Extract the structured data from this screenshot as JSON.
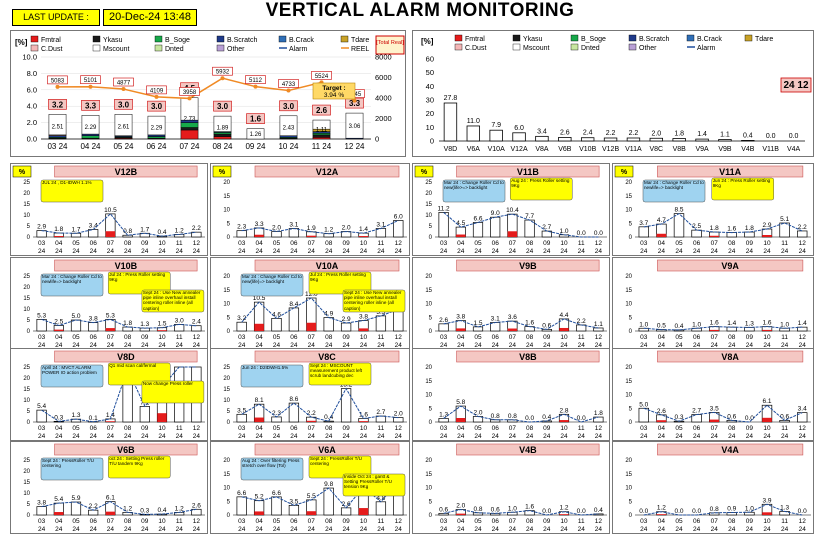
{
  "header": {
    "last_update_label": "LAST UPDATE :",
    "last_update_value": "20-Dec-24 13:48",
    "title": "VERTICAL ALARM MONITORING"
  },
  "colors": {
    "bar_outline": "#000000",
    "trend": "#1f4e9c",
    "reel": "#f08a24",
    "target": "#ffd966",
    "panel_title_bg": "#f4c7c3",
    "yellow": "#ffff00",
    "callout": "#9fd3f0"
  },
  "chart_data": [
    {
      "type": "bar",
      "id": "monthly",
      "unit_label": "[%]",
      "total_label": "[Total Real]",
      "categories": [
        "03 24",
        "04 24",
        "05 24",
        "06 24",
        "07 24",
        "08 24",
        "09 24",
        "10 24",
        "11 24",
        "12 24"
      ],
      "ylim": [
        0,
        10
      ],
      "y2lim": [
        0,
        8000
      ],
      "yticks": [
        "0.0",
        "2.0",
        "4.0",
        "6.0",
        "8.0",
        "10.0"
      ],
      "y2ticks": [
        "0",
        "2000",
        "4000",
        "6000",
        "8000"
      ],
      "legend": [
        "Fmtral",
        "Ykasu",
        "B_Soge",
        "B.Scratch",
        "B.Crack",
        "Tdare",
        "C.Dust",
        "Mscount",
        "Dnted",
        "Other",
        "Alarm",
        "REEL"
      ],
      "series": [
        {
          "name": "Fmtral",
          "color": "#e51c1c",
          "values": [
            0,
            0,
            0.1,
            0,
            1.1,
            0.3,
            0,
            0,
            0.2,
            0
          ]
        },
        {
          "name": "Ykasu",
          "color": "#1a1a1a",
          "values": [
            0.1,
            0.1,
            0.1,
            0.1,
            0.3,
            0.3,
            0,
            0.1,
            0.3,
            0
          ]
        },
        {
          "name": "B_Soge",
          "color": "#17a84a",
          "values": [
            0.1,
            0.3,
            0.1,
            0.2,
            0.6,
            0.2,
            0,
            0.1,
            0.2,
            0
          ]
        },
        {
          "name": "B.Scratch",
          "color": "#1f3a8a",
          "values": [
            0.2,
            0.2,
            0.1,
            0.2,
            0.3,
            0.1,
            0,
            0.2,
            0.2,
            0.1
          ]
        },
        {
          "name": "B.Crack",
          "color": "#2f6fb7",
          "values": [
            0,
            0,
            0,
            0,
            0,
            0,
            0,
            0,
            0,
            0
          ]
        },
        {
          "name": "Tdare",
          "color": "#c9a227",
          "values": [
            0,
            0,
            0,
            0,
            0,
            0,
            0,
            0,
            0.3,
            0
          ]
        },
        {
          "name": "C.Dust",
          "color": "#f4b6b6",
          "values": [
            0.1,
            0,
            0,
            0,
            0,
            0,
            0,
            0,
            0,
            0
          ]
        },
        {
          "name": "Mscount",
          "color": "#ffffff",
          "values": [
            2.51,
            2.29,
            2.61,
            2.29,
            2.73,
            1.89,
            1.26,
            2.43,
            1.11,
            3.06
          ]
        },
        {
          "name": "Dnted",
          "color": "#c8e6a0",
          "values": [
            0,
            0,
            0,
            0,
            0,
            0,
            0,
            0,
            0,
            0
          ]
        },
        {
          "name": "Other",
          "color": "#b9a0d6",
          "values": [
            0,
            0,
            0,
            0,
            0,
            0,
            0,
            0,
            0,
            0
          ]
        }
      ],
      "totals": [
        "3.2",
        "3.3",
        "3.0",
        "3.0",
        "4.5",
        "3.0",
        "1.6",
        "3.0",
        "2.6",
        "3.3"
      ],
      "inner_labels": [
        "2.51",
        "2.29",
        "2.61",
        "2.29",
        "2.73",
        "1.89",
        "1.26",
        "2.43",
        "1.11",
        "3.06"
      ],
      "alarm_line": [
        3.2,
        3.3,
        3.0,
        3.0,
        4.5,
        3.0,
        1.6,
        3.0,
        2.6,
        3.3
      ],
      "reel": [
        5083,
        5101,
        4877,
        4109,
        3958,
        5932,
        5112,
        4733,
        5524,
        3745
      ],
      "reel_labels": [
        "5083",
        "5101",
        "4877",
        "4109",
        "3958",
        "5932",
        "5112",
        "4733",
        "5524",
        "3745"
      ],
      "target_label": "Target :",
      "target_value": "3.94 %"
    },
    {
      "type": "bar",
      "id": "machines",
      "unit_label": "[%]",
      "categories": [
        "V8D",
        "V6A",
        "V10A",
        "V12A",
        "V8A",
        "V6B",
        "V10B",
        "V12B",
        "V11A",
        "V8C",
        "V8B",
        "V9A",
        "V9B",
        "V4B",
        "V11B",
        "V4A"
      ],
      "values": [
        27.8,
        11.0,
        7.9,
        6.0,
        3.4,
        2.6,
        2.4,
        2.2,
        2.2,
        2.0,
        1.8,
        1.4,
        1.1,
        0.4,
        0.0,
        0.0
      ],
      "value_labels": [
        "27.8",
        "11.0",
        "7.9",
        "6.0",
        "3.4",
        "2.6",
        "2.4",
        "2.2",
        "2.2",
        "2.0",
        "1.8",
        "1.4",
        "1.1",
        "0.4",
        "0.0",
        "0.0"
      ],
      "ylim": [
        0,
        60
      ],
      "yticks": [
        "0",
        "10",
        "20",
        "30",
        "40",
        "50",
        "60"
      ],
      "legend": [
        "Fmtral",
        "Ykasu",
        "B_Soge",
        "B.Scratch",
        "B.Crack",
        "Tdare",
        "C.Dust",
        "Mscount",
        "Dnted",
        "Other",
        "Alarm"
      ],
      "badge": "24 12"
    }
  ],
  "machine_months": [
    "03",
    "04",
    "05",
    "06",
    "07",
    "08",
    "09",
    "10",
    "11",
    "12"
  ],
  "machine_year": "24",
  "machines": [
    {
      "name": "V12B",
      "pct": "%",
      "values": [
        2.9,
        1.8,
        1.7,
        3.4,
        10.5,
        0.8,
        1.7,
        0.4,
        1.2,
        2.2
      ],
      "labels": [
        "2.9",
        "1.8",
        "1.7",
        "3.4",
        "10.5",
        "0.8",
        "1.7",
        "0.4",
        "1.2",
        "2.2"
      ],
      "ylim": [
        0,
        25
      ],
      "yticks": [
        "0",
        "5",
        "10",
        "15",
        "20",
        "25"
      ],
      "callouts": [
        "JUL 24 , D1-IDWH 1.1%"
      ]
    },
    {
      "name": "V12A",
      "pct": "%",
      "values": [
        2.3,
        3.3,
        2.0,
        3.1,
        1.9,
        1.2,
        2.0,
        1.4,
        3.1,
        6.0
      ],
      "labels": [
        "2.3",
        "3.3",
        "2.0",
        "3.1",
        "1.9",
        "1.2",
        "2.0",
        "1.4",
        "3.1",
        "6.0"
      ],
      "ylim": [
        0,
        20
      ],
      "yticks": [
        "0",
        "5",
        "10",
        "15",
        "20"
      ],
      "callouts": []
    },
    {
      "name": "V11B",
      "pct": "%",
      "values": [
        11.2,
        4.5,
        6.6,
        9.0,
        10.4,
        7.7,
        2.7,
        1.0,
        0.0,
        0.0
      ],
      "labels": [
        "11.2",
        "4.5",
        "6.6",
        "9.0",
        "10.4",
        "7.7",
        "2.7",
        "1.0",
        "0.0",
        "0.0"
      ],
      "ylim": [
        0,
        25
      ],
      "yticks": [
        "0",
        "5",
        "10",
        "15",
        "20",
        "25"
      ],
      "callouts": [
        "Mar 24 : Change Roller Cd to new(life>=> backlight",
        "Aug 24 : Press Roller setting 9Kg"
      ]
    },
    {
      "name": "V11A",
      "pct": "%",
      "values": [
        3.7,
        4.7,
        8.5,
        2.5,
        1.8,
        1.6,
        1.8,
        2.9,
        5.1,
        2.2
      ],
      "labels": [
        "3.7",
        "4.7",
        "8.5",
        "2.5",
        "1.8",
        "1.6",
        "1.8",
        "2.9",
        "5.1",
        "2.2"
      ],
      "ylim": [
        0,
        20
      ],
      "yticks": [
        "0",
        "5",
        "10",
        "15",
        "20"
      ],
      "callouts": [
        "Mar 24 : Change Roller Cd to newlife=> backlight",
        "Jun 24 : Press Roller setting 9Kg"
      ]
    },
    {
      "name": "V10B",
      "pct": "",
      "values": [
        5.3,
        2.5,
        5.0,
        3.8,
        5.3,
        1.8,
        1.3,
        1.5,
        3.0,
        2.4
      ],
      "labels": [
        "5.3",
        "2.5",
        "5.0",
        "3.8",
        "5.3",
        "1.8",
        "1.3",
        "1.5",
        "3.0",
        "2.4"
      ],
      "ylim": [
        0,
        25
      ],
      "yticks": [
        "0",
        "5",
        "10",
        "15",
        "20",
        "25"
      ],
      "callouts": [
        "Mar 24 : Change Roller Cd to newlife=> backlight",
        "Jul 24 : Press Roller setting 9Kg",
        "Sept 24 : Use New annealer pipe inline overhaul install centering roller inline (all caption)"
      ]
    },
    {
      "name": "V10A",
      "pct": "",
      "values": [
        3.2,
        10.5,
        4.6,
        8.4,
        12.0,
        4.9,
        2.9,
        3.8,
        5.5,
        7.9
      ],
      "labels": [
        "3.2",
        "10.5",
        "4.6",
        "8.4",
        "12.0",
        "4.9",
        "2.9",
        "3.8",
        "5.5",
        "7.9"
      ],
      "ylim": [
        0,
        20
      ],
      "yticks": [
        "0",
        "5",
        "10",
        "15",
        "20"
      ],
      "callouts": [
        "Mar 24 : Change Roller Cd to new(life)=> backlight",
        "Jul 24 : Press Roller setting 9Kg",
        "Sept 24 : Use New annealer pipe inline overhaul install centering roller inline (all caption)"
      ]
    },
    {
      "name": "V9B",
      "pct": "",
      "values": [
        2.6,
        3.8,
        1.5,
        3.1,
        3.6,
        1.6,
        0.6,
        4.4,
        2.2,
        1.1
      ],
      "labels": [
        "2.6",
        "3.8",
        "1.5",
        "3.1",
        "3.6",
        "1.6",
        "0.6",
        "4.4",
        "2.2",
        "1.1"
      ],
      "ylim": [
        0,
        20
      ],
      "yticks": [
        "0",
        "5",
        "10",
        "15",
        "20"
      ],
      "callouts": []
    },
    {
      "name": "V9A",
      "pct": "",
      "values": [
        1.0,
        0.5,
        0.4,
        1.0,
        1.6,
        1.4,
        1.3,
        1.6,
        1.0,
        1.4
      ],
      "labels": [
        "1.0",
        "0.5",
        "0.4",
        "1.0",
        "1.6",
        "1.4",
        "1.3",
        "1.6",
        "1.0",
        "1.4"
      ],
      "ylim": [
        0,
        20
      ],
      "yticks": [
        "0",
        "5",
        "10",
        "15",
        "20"
      ],
      "callouts": []
    },
    {
      "name": "V8D",
      "pct": "",
      "values": [
        5.4,
        0.3,
        1.3,
        0.1,
        1.4,
        24.0,
        7.1,
        16.0,
        31.0,
        48.0
      ],
      "labels": [
        "5.4",
        "0.3",
        "1.3",
        "0.1",
        "1.4",
        "",
        "7.1",
        "",
        "",
        ""
      ],
      "ylim": [
        0,
        25
      ],
      "yticks": [
        "0",
        "5",
        "10",
        "15",
        "20",
        "25"
      ],
      "callouts": [
        "April 24 : MVCT ALARM POWER IO action problem",
        "Q1 mid scan cal/fermal",
        "Now change Press roller"
      ]
    },
    {
      "name": "V8C",
      "pct": "",
      "values": [
        3.5,
        8.1,
        2.3,
        8.6,
        2.2,
        0.4,
        15.2,
        1.6,
        2.7,
        2.0
      ],
      "labels": [
        "3.5",
        "8.1",
        "2.3",
        "8.6",
        "2.2",
        "0.4",
        "15.2",
        "1.6",
        "2.7",
        "2.0"
      ],
      "ylim": [
        0,
        25
      ],
      "yticks": [
        "0",
        "5",
        "10",
        "15",
        "20",
        "25"
      ],
      "callouts": [
        "Jun 24 : D2IDWH1.5%",
        "Sept 24 : MSCOUNT measurement product left scrub landcubing dec"
      ]
    },
    {
      "name": "V8B",
      "pct": "",
      "values": [
        1.3,
        5.8,
        2.0,
        0.8,
        0.8,
        0.0,
        0.4,
        2.8,
        0.0,
        1.8
      ],
      "labels": [
        "1.3",
        "5.8",
        "2.0",
        "0.8",
        "0.8",
        "0.0",
        "0.4",
        "2.8",
        "0.0",
        "1.8"
      ],
      "ylim": [
        0,
        20
      ],
      "yticks": [
        "0",
        "5",
        "10",
        "15",
        "20"
      ],
      "callouts": []
    },
    {
      "name": "V8A",
      "pct": "",
      "values": [
        5.0,
        2.6,
        0.3,
        2.7,
        3.5,
        0.6,
        0.0,
        6.1,
        0.6,
        3.4
      ],
      "labels": [
        "5.0",
        "2.6",
        "0.3",
        "2.7",
        "3.5",
        "0.6",
        "0.0",
        "6.1",
        "0.6",
        "3.4"
      ],
      "ylim": [
        0,
        20
      ],
      "yticks": [
        "0",
        "5",
        "10",
        "15",
        "20"
      ],
      "callouts": []
    },
    {
      "name": "V6B",
      "pct": "",
      "values": [
        3.8,
        5.4,
        5.9,
        2.2,
        6.1,
        1.2,
        0.3,
        0.4,
        1.2,
        2.6
      ],
      "labels": [
        "3.8",
        "5.4",
        "5.9",
        "2.2",
        "6.1",
        "1.2",
        "0.3",
        "0.4",
        "1.2",
        "2.6"
      ],
      "ylim": [
        0,
        25
      ],
      "yticks": [
        "0",
        "5",
        "10",
        "15",
        "20",
        "25"
      ],
      "callouts": [
        "Sept 24 : PressRoller T/U centering",
        "oct 24 : Setting Press roller T/U tandem 9Kg"
      ]
    },
    {
      "name": "V6A",
      "pct": "",
      "values": [
        6.6,
        5.2,
        6.6,
        3.5,
        5.5,
        9.8,
        2.6,
        10.1,
        4.8,
        12.4
      ],
      "labels": [
        "6.6",
        "5.2",
        "6.6",
        "3.5",
        "5.5",
        "9.8",
        "2.6",
        "10.1",
        "4.8",
        "12.4"
      ],
      "ylim": [
        0,
        20
      ],
      "yticks": [
        "0",
        "5",
        "10",
        "15",
        "20"
      ],
      "callouts": [
        "Aug 24 : Over filtering Press stretch over flow (Tol)",
        "Sept 24 : PressRoller T/U centering",
        "Inside Oct 24 : gantt & Setting PressRoller T/U tension 9Kg"
      ]
    },
    {
      "name": "V4B",
      "pct": "",
      "values": [
        0.6,
        2.0,
        0.8,
        0.6,
        1.0,
        1.6,
        0.0,
        1.2,
        0.0,
        0.4
      ],
      "labels": [
        "0.6",
        "2.0",
        "0.8",
        "0.6",
        "1.0",
        "1.6",
        "0.0",
        "1.2",
        "0.0",
        "0.4"
      ],
      "ylim": [
        0,
        20
      ],
      "yticks": [
        "0",
        "5",
        "10",
        "15",
        "20"
      ],
      "callouts": []
    },
    {
      "name": "V4A",
      "pct": "",
      "values": [
        0.0,
        1.2,
        0.0,
        0.0,
        0.8,
        0.9,
        1.0,
        3.9,
        1.3,
        0.0
      ],
      "labels": [
        "0.0",
        "1.2",
        "0.0",
        "0.0",
        "0.8",
        "0.9",
        "1.0",
        "3.9",
        "1.3",
        "0.0"
      ],
      "ylim": [
        0,
        20
      ],
      "yticks": [
        "0",
        "5",
        "10",
        "15",
        "20"
      ],
      "callouts": []
    }
  ]
}
